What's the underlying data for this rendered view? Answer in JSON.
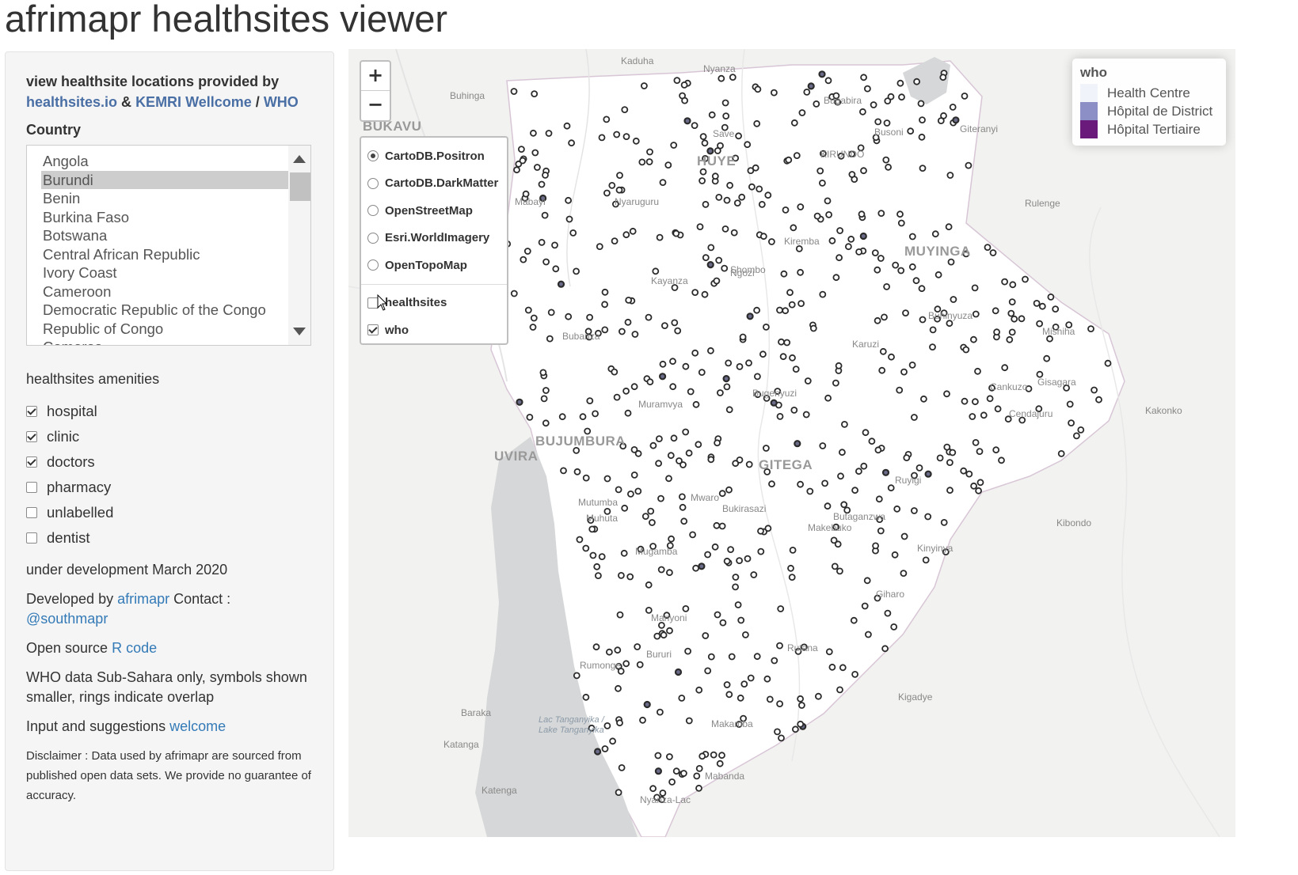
{
  "app_title": "afrimapr healthsites viewer",
  "sidebar": {
    "intro": {
      "text": "view healthsite locations provided by",
      "link1": "healthsites.io",
      "amp": "&",
      "link2": "KEMRI Wellcome",
      "slash": "/",
      "link3": "WHO"
    },
    "country_label": "Country",
    "countries": [
      {
        "label": "Angola",
        "selected": false
      },
      {
        "label": "Burundi",
        "selected": true
      },
      {
        "label": "Benin",
        "selected": false
      },
      {
        "label": "Burkina Faso",
        "selected": false
      },
      {
        "label": "Botswana",
        "selected": false
      },
      {
        "label": "Central African Republic",
        "selected": false
      },
      {
        "label": "Ivory Coast",
        "selected": false
      },
      {
        "label": "Cameroon",
        "selected": false
      },
      {
        "label": "Democratic Republic of the Congo",
        "selected": false
      },
      {
        "label": "Republic of Congo",
        "selected": false
      },
      {
        "label": "Comoros",
        "selected": false
      }
    ],
    "amenities_label": "healthsites amenities",
    "amenities": [
      {
        "label": "hospital",
        "checked": true
      },
      {
        "label": "clinic",
        "checked": true
      },
      {
        "label": "doctors",
        "checked": true
      },
      {
        "label": "pharmacy",
        "checked": false
      },
      {
        "label": "unlabelled",
        "checked": false
      },
      {
        "label": "dentist",
        "checked": false
      }
    ],
    "dev_note": "under development March 2020",
    "developed_by": {
      "text": "Developed by",
      "link": "afrimapr",
      "contact": "Contact :",
      "handle": "@southmapr"
    },
    "open_source": {
      "text": "Open source",
      "link": "R code"
    },
    "who_note": "WHO data Sub-Sahara only, symbols shown smaller, rings indicate overlap",
    "input": {
      "text": "Input and suggestions",
      "link": "welcome"
    },
    "disclaimer": "Disclaimer : Data used by afrimapr are sourced from published open data sets. We provide no guarantee of accuracy."
  },
  "map": {
    "zoom_in": "+",
    "zoom_out": "−",
    "base_layers": [
      {
        "label": "CartoDB.Positron",
        "selected": true
      },
      {
        "label": "CartoDB.DarkMatter",
        "selected": false
      },
      {
        "label": "OpenStreetMap",
        "selected": false
      },
      {
        "label": "Esri.WorldImagery",
        "selected": false
      },
      {
        "label": "OpenTopoMap",
        "selected": false
      }
    ],
    "overlays": [
      {
        "label": "healthsites",
        "checked": false
      },
      {
        "label": "who",
        "checked": true
      }
    ],
    "legend": {
      "title": "who",
      "items": [
        {
          "label": "Health Centre",
          "color": "#f0f3fa"
        },
        {
          "label": "Hôpital de District",
          "color": "#8c8fc6"
        },
        {
          "label": "Hôpital Tertiaire",
          "color": "#6a1a7a"
        }
      ]
    },
    "places": [
      {
        "name": "BUKAVU",
        "kind": "big"
      },
      {
        "name": "HUYE",
        "kind": "big"
      },
      {
        "name": "UVIRA",
        "kind": "big"
      },
      {
        "name": "Kaduha",
        "kind": "small"
      },
      {
        "name": "Nyanza",
        "kind": "small"
      },
      {
        "name": "Buhinga",
        "kind": "small"
      },
      {
        "name": "Save",
        "kind": "small"
      },
      {
        "name": "Nyaruguru",
        "kind": "small"
      },
      {
        "name": "Rulenge",
        "kind": "small"
      },
      {
        "name": "Kakonko",
        "kind": "small"
      },
      {
        "name": "Kibondo",
        "kind": "small"
      },
      {
        "name": "Kigadye",
        "kind": "small"
      },
      {
        "name": "Baraka",
        "kind": "small"
      },
      {
        "name": "Katanga",
        "kind": "small"
      },
      {
        "name": "Katenga",
        "kind": "small"
      },
      {
        "name": "Lac Tanganyika / Lake Tanganyika",
        "kind": "lake"
      },
      {
        "name": "KIRUNDO",
        "kind": "small"
      },
      {
        "name": "MUYINGA",
        "kind": "big"
      },
      {
        "name": "BUJUMBURA",
        "kind": "big"
      },
      {
        "name": "GITEGA",
        "kind": "big"
      },
      {
        "name": "Muramvya",
        "kind": "small"
      },
      {
        "name": "Ngozi",
        "kind": "small"
      },
      {
        "name": "Kayanza",
        "kind": "small"
      },
      {
        "name": "Bubanza",
        "kind": "small"
      },
      {
        "name": "Karuzi",
        "kind": "small"
      },
      {
        "name": "Cankuzo",
        "kind": "small"
      },
      {
        "name": "Ruyigi",
        "kind": "small"
      },
      {
        "name": "Rutana",
        "kind": "small"
      },
      {
        "name": "Bururi",
        "kind": "small"
      },
      {
        "name": "Makamba",
        "kind": "small"
      },
      {
        "name": "Rumonge",
        "kind": "small"
      },
      {
        "name": "Mutumba",
        "kind": "small"
      },
      {
        "name": "Muhuta",
        "kind": "small"
      },
      {
        "name": "Mugamba",
        "kind": "small"
      },
      {
        "name": "Manyoni",
        "kind": "small"
      },
      {
        "name": "Mabanda",
        "kind": "small"
      },
      {
        "name": "Nyanza-Lac",
        "kind": "small"
      },
      {
        "name": "Bugenyuzi",
        "kind": "small"
      },
      {
        "name": "Mwaro",
        "kind": "small"
      },
      {
        "name": "Butaganzwa",
        "kind": "small"
      },
      {
        "name": "Giharo",
        "kind": "small"
      },
      {
        "name": "Kinyinya",
        "kind": "small"
      },
      {
        "name": "Gisagara",
        "kind": "small"
      },
      {
        "name": "Cendajuru",
        "kind": "small"
      },
      {
        "name": "Mishiha",
        "kind": "small"
      },
      {
        "name": "Buhinyuza",
        "kind": "small"
      },
      {
        "name": "Kiremba",
        "kind": "small"
      },
      {
        "name": "Bugabira",
        "kind": "small"
      },
      {
        "name": "Busoni",
        "kind": "small"
      },
      {
        "name": "Giteranyi",
        "kind": "small"
      },
      {
        "name": "Mabayi",
        "kind": "small"
      },
      {
        "name": "Shombo",
        "kind": "small"
      },
      {
        "name": "Bukirasazi",
        "kind": "small"
      },
      {
        "name": "Makebuko",
        "kind": "small"
      }
    ]
  }
}
